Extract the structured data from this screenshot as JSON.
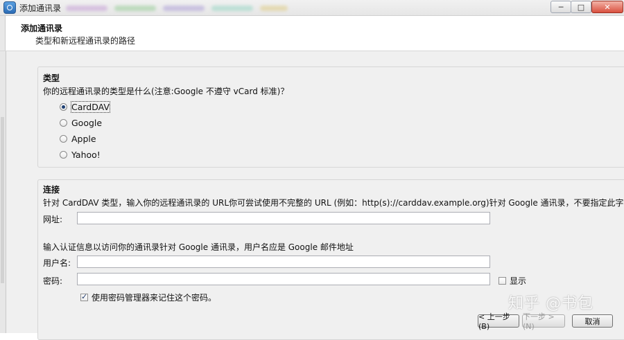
{
  "window": {
    "title": "添加通讯录",
    "controls": {
      "minimize": "─",
      "maximize": "□",
      "close": "✕"
    }
  },
  "header": {
    "title": "添加通讯录",
    "subtitle": "类型和新远程通讯录的路径"
  },
  "type_group": {
    "title": "类型",
    "question": "你的远程通讯录的类型是什么(注意:Google 不遵守 vCard 标准)？",
    "options": [
      {
        "label": "CardDAV",
        "selected": true
      },
      {
        "label": "Google",
        "selected": false
      },
      {
        "label": "Apple",
        "selected": false
      },
      {
        "label": "Yahoo!",
        "selected": false
      }
    ]
  },
  "connect_group": {
    "title": "连接",
    "description": "针对 CardDAV 类型，输入你的远程通讯录的 URL你可尝试使用不完整的 URL (例如：http(s)://carddav.example.org)针对 Google 通讯录，不要指定此字段",
    "url_label": "网址:",
    "url_value": "",
    "auth_hint": "输入认证信息以访问你的通讯录针对 Google 通讯录，用户名应是 Google 邮件地址",
    "username_label": "用户名:",
    "username_value": "",
    "password_label": "密码:",
    "password_value": "",
    "show_label": "显示",
    "show_checked": false,
    "password_manager_label": "使用密码管理器来记住这个密码。",
    "password_manager_checked": true
  },
  "buttons": {
    "back": "< 上一步(B)",
    "next": "下一步 > (N)",
    "cancel": "取消"
  },
  "watermark": "知乎 @书包",
  "colors": {
    "accent": "#1d3f73",
    "panel": "#f0f0f0",
    "close": "#d9503f"
  }
}
